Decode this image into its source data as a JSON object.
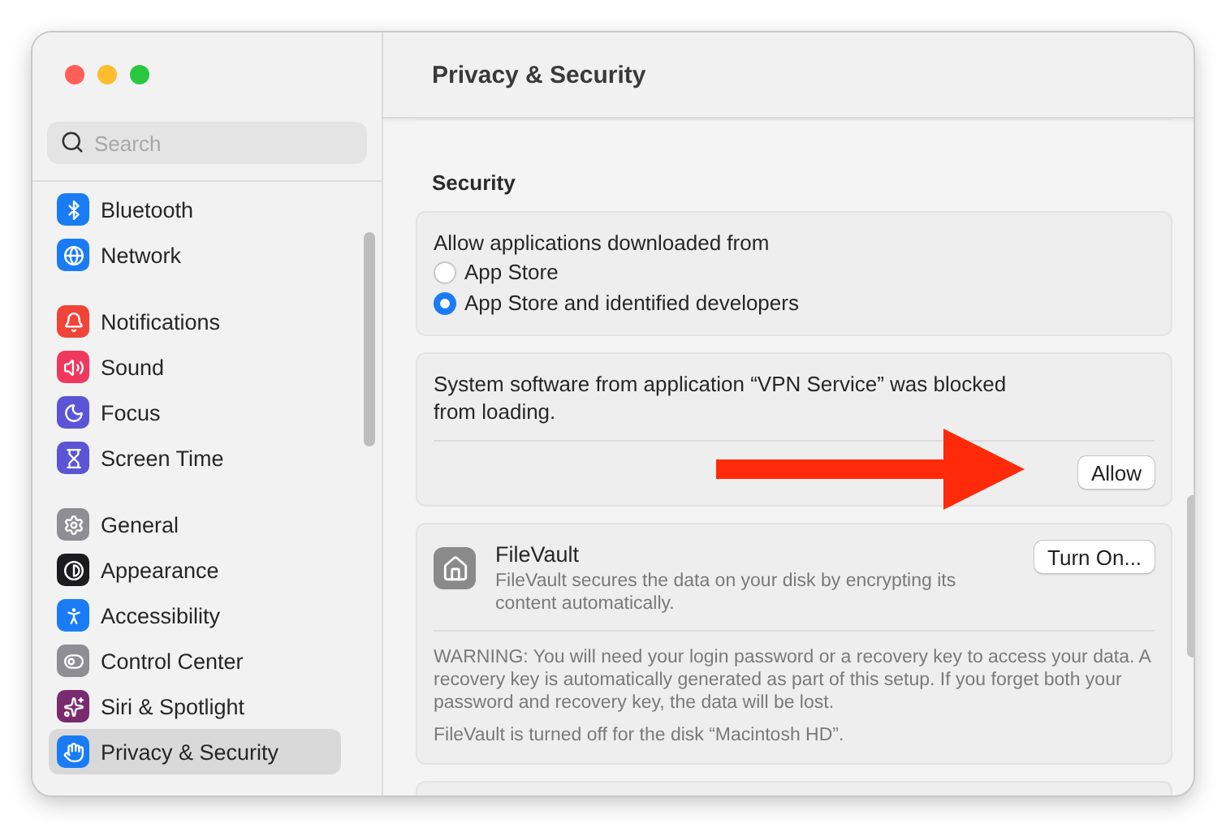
{
  "window": {
    "title": "Privacy & Security"
  },
  "sidebar": {
    "search": {
      "placeholder": "Search"
    },
    "groups": [
      [
        {
          "label": "Bluetooth",
          "kind": "bluetooth",
          "color": "#1a7cf5",
          "selected": false
        },
        {
          "label": "Network",
          "kind": "network",
          "color": "#1a7cf5",
          "selected": false
        }
      ],
      [
        {
          "label": "Notifications",
          "kind": "notifications",
          "color": "#f04438",
          "selected": false
        },
        {
          "label": "Sound",
          "kind": "sound",
          "color": "#f0385e",
          "selected": false
        },
        {
          "label": "Focus",
          "kind": "focus",
          "color": "#5b55d6",
          "selected": false
        },
        {
          "label": "Screen Time",
          "kind": "screen-time",
          "color": "#5b55d6",
          "selected": false
        }
      ],
      [
        {
          "label": "General",
          "kind": "general",
          "color": "#8e8e93",
          "selected": false
        },
        {
          "label": "Appearance",
          "kind": "appearance",
          "color": "#1c1c1e",
          "selected": false
        },
        {
          "label": "Accessibility",
          "kind": "accessibility",
          "color": "#1a7cf5",
          "selected": false
        },
        {
          "label": "Control Center",
          "kind": "control-center",
          "color": "#8e8e93",
          "selected": false
        },
        {
          "label": "Siri & Spotlight",
          "kind": "siri",
          "color": "#7a2a6e",
          "selected": false
        },
        {
          "label": "Privacy & Security",
          "kind": "privacy",
          "color": "#1a7cf5",
          "selected": true
        }
      ]
    ]
  },
  "content": {
    "section_title": "Security",
    "download_card": {
      "label": "Allow applications downloaded from",
      "options": [
        {
          "label": "App Store",
          "selected": false
        },
        {
          "label": "App Store and identified developers",
          "selected": true
        }
      ]
    },
    "blocked_card": {
      "message": "System software from application “VPN Service” was blocked from loading.",
      "button": "Allow"
    },
    "filevault_card": {
      "title": "FileVault",
      "description": "FileVault secures the data on your disk by encrypting its content automatically.",
      "button": "Turn On...",
      "warning": "WARNING: You will need your login password or a recovery key to access your data. A recovery key is automatically generated as part of this setup. If you forget both your password and recovery key, the data will be lost.",
      "status": "FileVault is turned off for the disk “Macintosh HD”."
    }
  }
}
